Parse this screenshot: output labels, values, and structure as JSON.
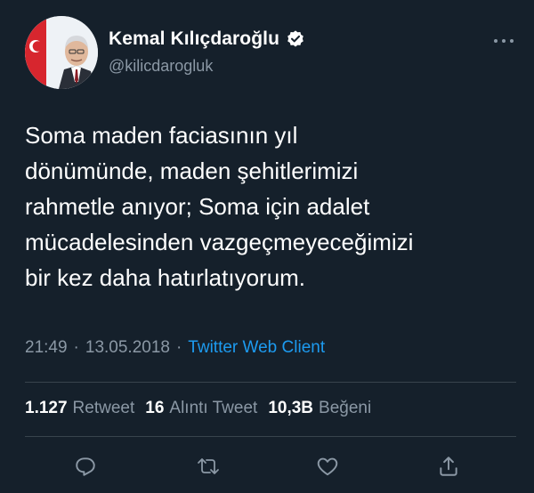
{
  "author": {
    "name": "Kemal Kılıçdaroğlu",
    "handle": "@kilicdarogluk"
  },
  "tweet": {
    "text": "Soma maden faciasının yıl\ndönümünde, maden şehitlerimizi\nrahmetle anıyor; Soma için adalet\nmücadelesinden vazgeçmeyeceğimizi\nbir kez daha hatırlatıyorum.",
    "time": "21:49",
    "date": "13.05.2018",
    "separator": "·",
    "client": "Twitter Web Client"
  },
  "stats": {
    "retweets_count": "1.127",
    "retweets_label": "Retweet",
    "quotes_count": "16",
    "quotes_label": "Alıntı Tweet",
    "likes_count": "10,3B",
    "likes_label": "Beğeni"
  },
  "icons": {
    "more": "more-options-icon",
    "verified": "verified-badge-icon",
    "reply": "reply-icon",
    "retweet": "retweet-icon",
    "like": "heart-icon",
    "share": "share-icon"
  },
  "colors": {
    "background": "#15202b",
    "text": "#ffffff",
    "secondary": "#8b98a5",
    "accent": "#1d9bf0",
    "divider": "#38444d"
  }
}
